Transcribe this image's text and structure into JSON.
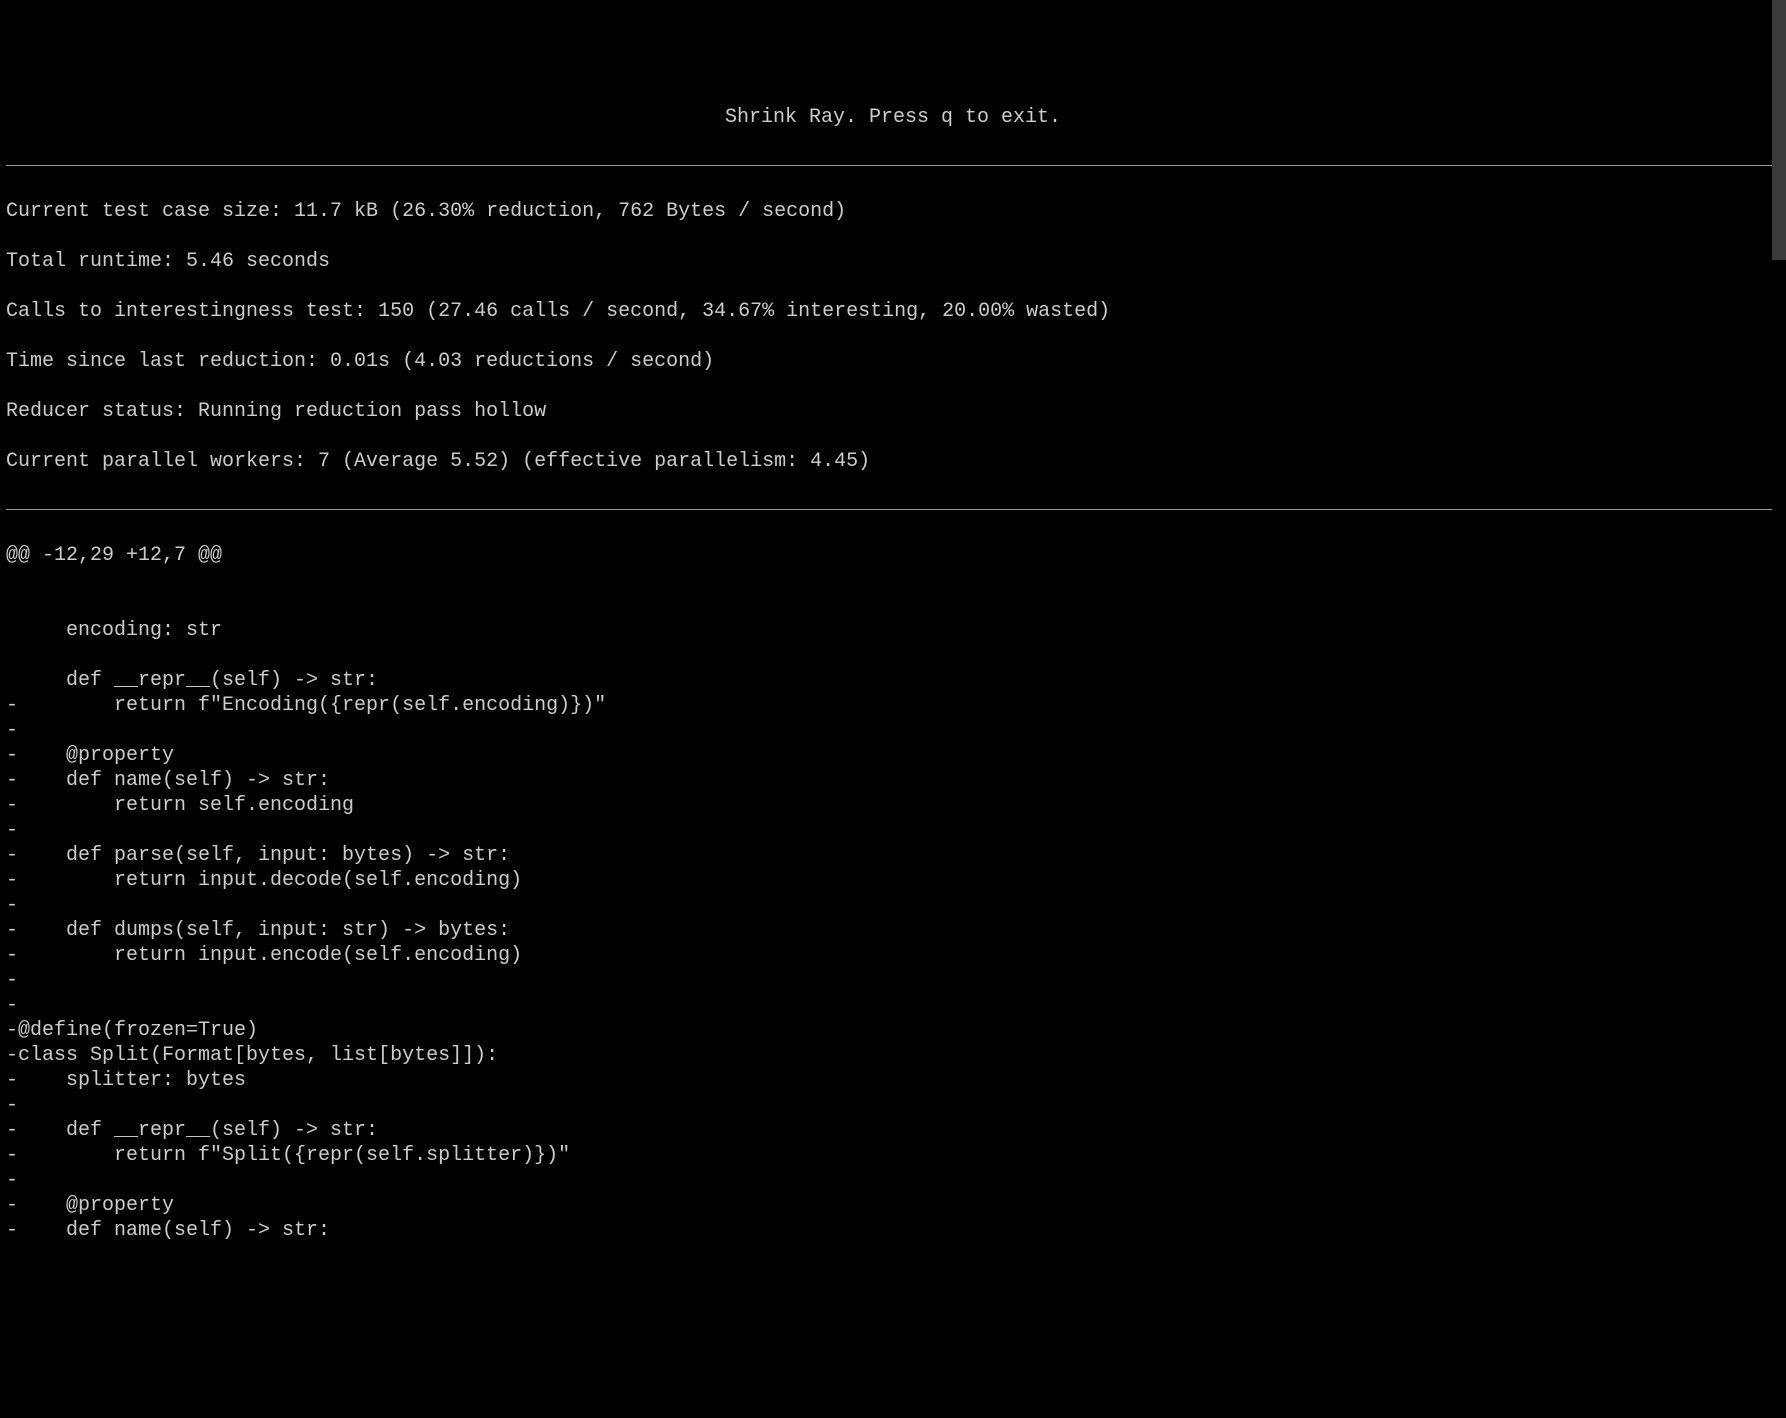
{
  "title": "Shrink Ray. Press q to exit.",
  "stats": {
    "current_size": "Current test case size: 11.7 kB (26.30% reduction, 762 Bytes / second)",
    "total_runtime": "Total runtime: 5.46 seconds",
    "calls": "Calls to interestingness test: 150 (27.46 calls / second, 34.67% interesting, 20.00% wasted)",
    "time_since_last": "Time since last reduction: 0.01s (4.03 reductions / second)",
    "reducer_status": "Reducer status: Running reduction pass hollow",
    "parallel_workers": "Current parallel workers: 7 (Average 5.52) (effective parallelism: 4.45)"
  },
  "diff": {
    "hunk_header": "@@ -12,29 +12,7 @@",
    "lines": [
      " ",
      "     encoding: str",
      " ",
      "     def __repr__(self) -> str:",
      "-        return f\"Encoding({repr(self.encoding)})\"",
      "-",
      "-    @property",
      "-    def name(self) -> str:",
      "-        return self.encoding",
      "-",
      "-    def parse(self, input: bytes) -> str:",
      "-        return input.decode(self.encoding)",
      "-",
      "-    def dumps(self, input: str) -> bytes:",
      "-        return input.encode(self.encoding)",
      "-",
      "-",
      "-@define(frozen=True)",
      "-class Split(Format[bytes, list[bytes]]):",
      "-    splitter: bytes",
      "-",
      "-    def __repr__(self) -> str:",
      "-        return f\"Split({repr(self.splitter)})\"",
      "-",
      "-    @property",
      "-    def name(self) -> str:"
    ]
  }
}
